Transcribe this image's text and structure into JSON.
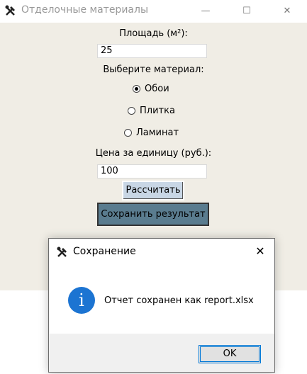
{
  "main_window": {
    "title": "Отделочные материалы",
    "controls": {
      "minimize": "—",
      "maximize": "☐",
      "close": "✕"
    }
  },
  "form": {
    "area_label": "Площадь (м²):",
    "area_value": "25",
    "material_label": "Выберите материал:",
    "materials": [
      {
        "label": "Обои",
        "selected": true
      },
      {
        "label": "Плитка",
        "selected": false
      },
      {
        "label": "Ламинат",
        "selected": false
      }
    ],
    "price_label": "Цена за единицу (руб.):",
    "price_value": "100",
    "calculate_button": "Рассчитать",
    "save_button": "Сохранить результат"
  },
  "dialog": {
    "title": "Сохранение",
    "close": "✕",
    "icon": "info-icon",
    "icon_glyph": "i",
    "message": "Отчет сохранен как report.xlsx",
    "ok_button": "OK",
    "accent_color": "#0078d7",
    "info_color": "#1c74d2"
  }
}
